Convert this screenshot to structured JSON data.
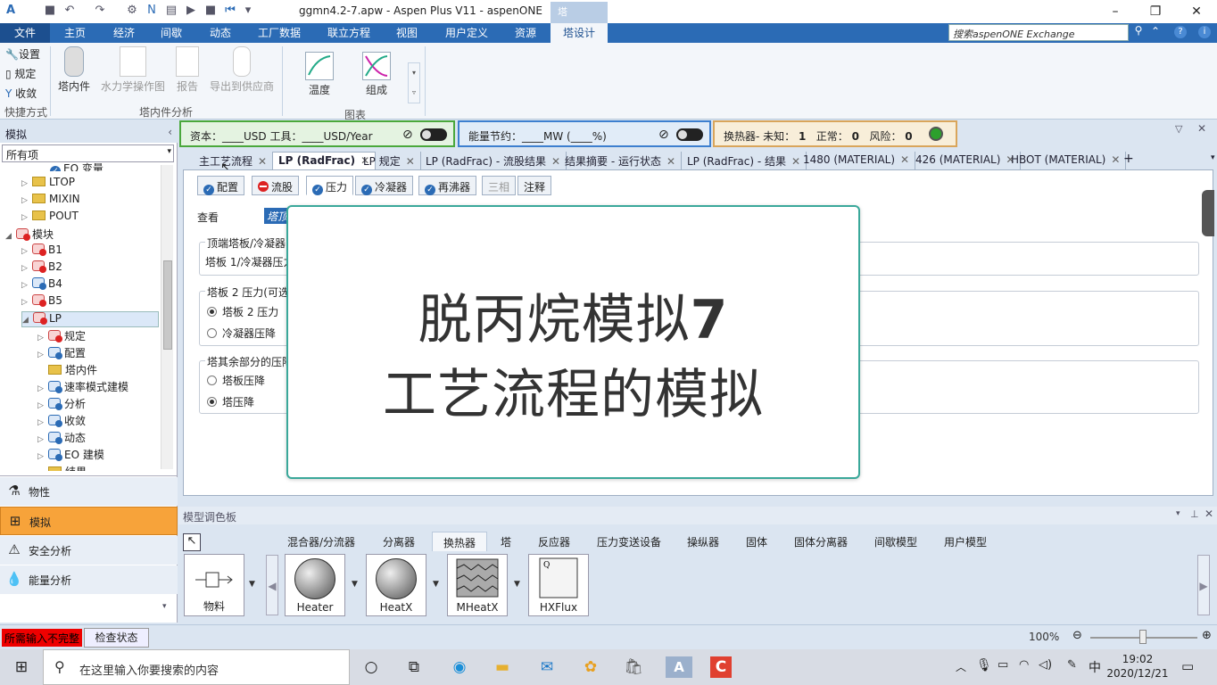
{
  "titlebar": {
    "title": "ggmn4.2-7.apw - Aspen Plus V11 - aspenONE",
    "context_tab": "塔"
  },
  "menubar": {
    "file": "文件",
    "items": [
      "主页",
      "经济",
      "间歇",
      "动态",
      "工厂数据",
      "联立方程",
      "视图",
      "用户定义",
      "资源"
    ],
    "active": "塔设计",
    "search_placeholder": "搜索aspenONE Exchange"
  },
  "ribbon": {
    "quick": {
      "setup": "设置",
      "spec": "规定",
      "collect": "收敛",
      "group": "快捷方式"
    },
    "internals": {
      "tray_internals": "塔内件",
      "hydraulic": "水力学操作图",
      "report": "报告",
      "export": "导出到供应商",
      "group": "塔内件分析"
    },
    "charts": {
      "temperature": "温度",
      "composition": "组成",
      "group": "图表"
    }
  },
  "strip": {
    "cost": "资本：____USD   工具：____USD/Year",
    "energy": "能量节约：____MW   (____%)",
    "hx": "换热器- 未知：",
    "hx_unknown": "1",
    "hx_normal_label": "正常：",
    "hx_normal": "0",
    "hx_risk_label": "风险：",
    "hx_risk": "0"
  },
  "nav": {
    "header": "模拟",
    "filter": "所有项",
    "tree": [
      "EO 变量",
      "LTOP",
      "MIXIN",
      "POUT",
      "模块",
      "B1",
      "B2",
      "B4",
      "B5",
      "LP",
      "规定",
      "配置",
      "塔内件",
      "速率模式建模",
      "分析",
      "收敛",
      "动态",
      "EO 建模",
      "结果"
    ],
    "sections": [
      "物性",
      "模拟",
      "安全分析",
      "能量分析"
    ]
  },
  "doc_tabs": [
    "主工艺流程",
    "LP (RadFrac)",
    "LP 规定",
    "LP (RadFrac) - 流股结果",
    "结果摘要 - 运行状态",
    "LP (RadFrac) - 结果",
    "1480 (MATERIAL)",
    "426 (MATERIAL)",
    "HBOT (MATERIAL)"
  ],
  "sub_tabs": [
    "配置",
    "流股",
    "压力",
    "冷凝器",
    "再沸器",
    "三相",
    "注释"
  ],
  "form": {
    "view_label": "查看",
    "view_value": "塔顶",
    "sec1_title": "顶端塔板/冷凝器",
    "sec1_field": "塔板 1/冷凝器压力",
    "sec2_title": "塔板 2 压力(可选)",
    "sec2_opt1": "塔板 2 压力",
    "sec2_opt2": "冷凝器压降",
    "sec3_title": "塔其余部分的压降",
    "sec3_opt1": "塔板压降",
    "sec3_opt2": "塔压降"
  },
  "overlay": {
    "line1": "脱丙烷模拟",
    "line1_num": "7",
    "line2": "工艺流程的模拟"
  },
  "palette": {
    "title": "模型调色板",
    "tabs": [
      "混合器/分流器",
      "分离器",
      "换热器",
      "塔",
      "反应器",
      "压力变送设备",
      "操纵器",
      "固体",
      "固体分离器",
      "间歇模型",
      "用户模型"
    ],
    "active_tab": "换热器",
    "items": [
      "物料",
      "Heater",
      "HeatX",
      "MHeatX",
      "HXFlux"
    ]
  },
  "status": {
    "required": "所需输入不完整",
    "check": "检查状态",
    "zoom": "100%"
  },
  "taskbar": {
    "search": "在这里输入你要搜索的内容",
    "ime": "中",
    "time": "19:02",
    "date": "2020/12/21"
  },
  "colors": {
    "accent": "#2b6bb5",
    "overlay_border": "#3aa89a",
    "required": "#e00000",
    "active_nav": "#f7a33a"
  }
}
